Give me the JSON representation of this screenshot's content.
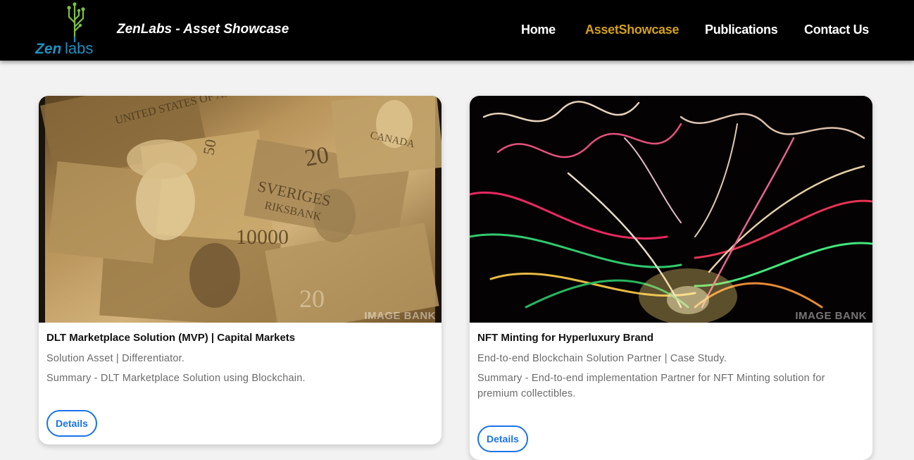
{
  "header": {
    "logo_text": "ZenLabs",
    "brand_title": "ZenLabs - Asset Showcase",
    "nav": [
      {
        "label": "Home",
        "active": false
      },
      {
        "label": "AssetShowcase",
        "active": true
      },
      {
        "label": "Publications",
        "active": false
      },
      {
        "label": "Contact Us",
        "active": false
      }
    ]
  },
  "colors": {
    "nav_bg": "#000000",
    "nav_active": "#d4a017",
    "button_accent": "#1a73e8",
    "page_bg": "#f2f2f2"
  },
  "cards": [
    {
      "image": "banknotes-photo",
      "title": "DLT Marketplace Solution (MVP) | Capital Markets",
      "subtitle": "Solution Asset | Differentiator.",
      "summary": "Summary - DLT Marketplace Solution using Blockchain.",
      "button_label": "Details"
    },
    {
      "image": "light-trails-photo",
      "title": "NFT Minting for Hyperluxury Brand",
      "subtitle": "End-to-end Blockchain Solution Partner | Case Study.",
      "summary": "Summary - End-to-end implementation Partner for NFT Minting solution for premium collectibles.",
      "button_label": "Details"
    }
  ]
}
